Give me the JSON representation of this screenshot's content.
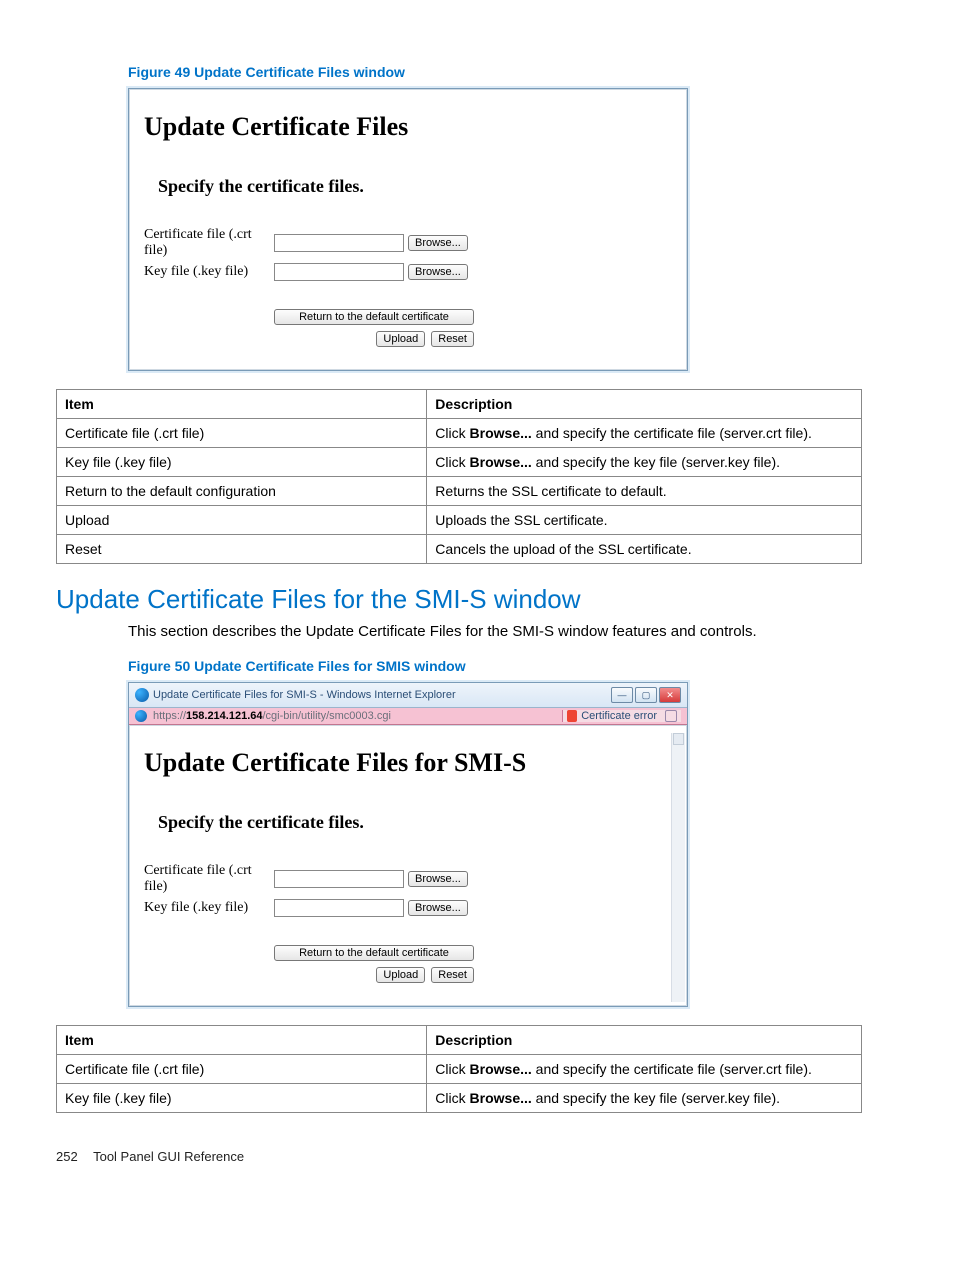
{
  "fig49_caption": "Figure 49 Update Certificate Files window",
  "panel1": {
    "title": "Update Certificate Files",
    "subtitle": "Specify the certificate files.",
    "row1_label": "Certificate file (.crt file)",
    "row2_label": "Key file (.key file)",
    "browse": "Browse...",
    "return_btn": "Return to the default certificate",
    "upload": "Upload",
    "reset": "Reset"
  },
  "table1": {
    "head_item": "Item",
    "head_desc": "Description",
    "rows": [
      {
        "item": "Certificate file (.crt file)",
        "desc_pre": "Click ",
        "desc_bold": "Browse...",
        "desc_post": " and specify the certificate file (server.crt file)."
      },
      {
        "item": "Key file (.key file)",
        "desc_pre": "Click ",
        "desc_bold": "Browse...",
        "desc_post": " and specify the key file (server.key file)."
      },
      {
        "item": "Return to the default configuration",
        "desc_pre": "Returns the SSL certificate to default.",
        "desc_bold": "",
        "desc_post": ""
      },
      {
        "item": "Upload",
        "desc_pre": "Uploads the SSL certificate.",
        "desc_bold": "",
        "desc_post": ""
      },
      {
        "item": "Reset",
        "desc_pre": "Cancels the upload of the SSL certificate.",
        "desc_bold": "",
        "desc_post": ""
      }
    ]
  },
  "section_heading": "Update Certificate Files for the SMI-S window",
  "section_body": "This section describes the Update Certificate Files for the SMI-S window features and controls.",
  "fig50_caption": "Figure 50 Update Certificate Files for SMIS window",
  "browser": {
    "title": "Update Certificate Files for SMI-S - Windows Internet Explorer",
    "url_prefix": "https://",
    "url_host": "158.214.121.64",
    "url_path": "/cgi-bin/utility/smc0003.cgi",
    "cert_error": "Certificate error"
  },
  "panel2": {
    "title": "Update Certificate Files for SMI-S",
    "subtitle": "Specify the certificate files.",
    "row1_label": "Certificate file (.crt file)",
    "row2_label": "Key file (.key file)",
    "browse": "Browse...",
    "return_btn": "Return to the default certificate",
    "upload": "Upload",
    "reset": "Reset"
  },
  "table2": {
    "head_item": "Item",
    "head_desc": "Description",
    "rows": [
      {
        "item": "Certificate file (.crt file)",
        "desc_pre": "Click ",
        "desc_bold": "Browse...",
        "desc_post": " and specify the certificate file (server.crt file)."
      },
      {
        "item": "Key file (.key file)",
        "desc_pre": "Click ",
        "desc_bold": "Browse...",
        "desc_post": " and specify the key file (server.key file)."
      }
    ]
  },
  "footer_page": "252",
  "footer_text": "Tool Panel GUI Reference"
}
